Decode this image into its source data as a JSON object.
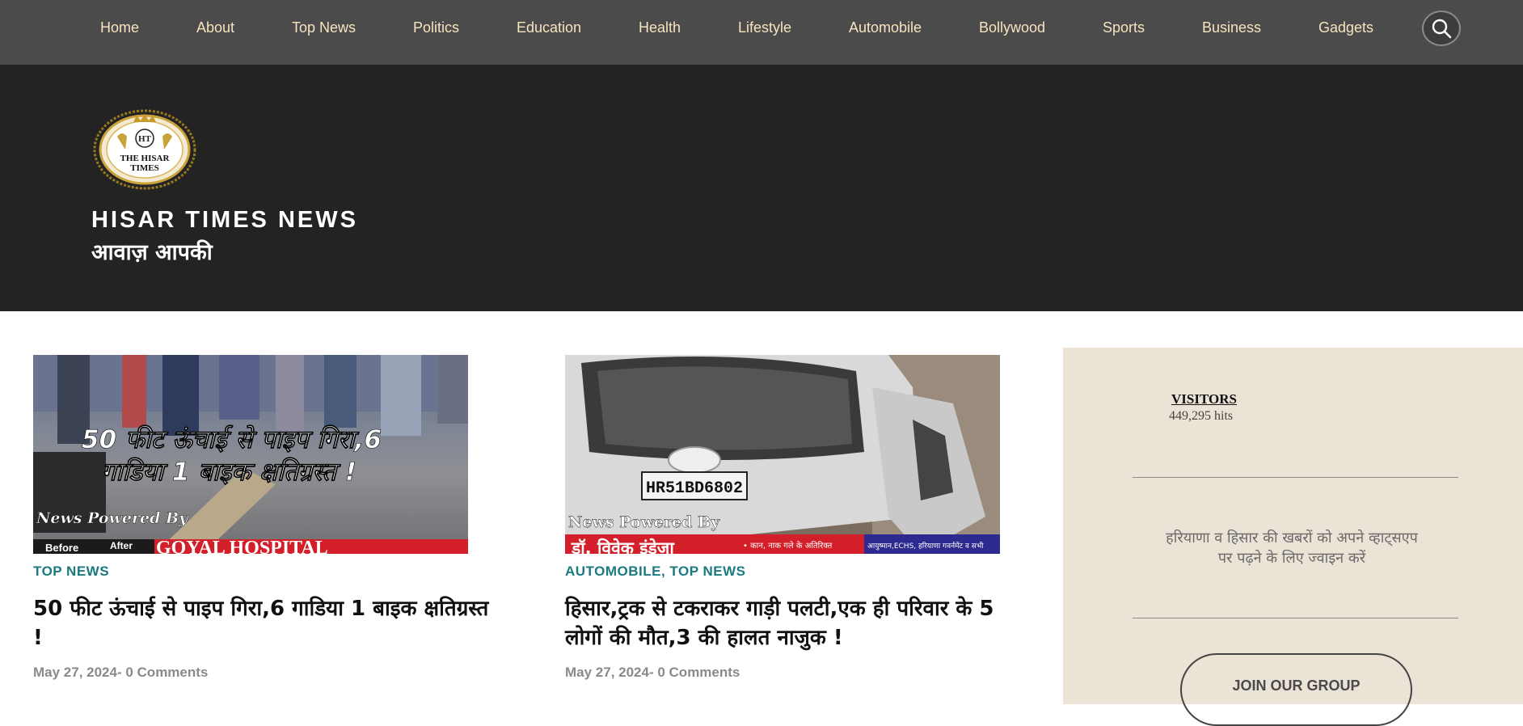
{
  "nav": {
    "items": [
      {
        "label": "Home"
      },
      {
        "label": "About"
      },
      {
        "label": "Top News"
      },
      {
        "label": "Politics"
      },
      {
        "label": "Education"
      },
      {
        "label": "Health"
      },
      {
        "label": "Lifestyle"
      },
      {
        "label": "Automobile"
      },
      {
        "label": "Bollywood"
      },
      {
        "label": "Sports"
      },
      {
        "label": "Business"
      },
      {
        "label": "Gadgets"
      }
    ],
    "search_icon": "search-icon"
  },
  "header": {
    "logo_text_top": "HT",
    "logo_text_main": "THE HISAR",
    "logo_text_sub": "TIMES",
    "title": "HISAR TIMES NEWS",
    "tagline": "आवाज़ आपकी"
  },
  "posts": [
    {
      "image_caption": "50 फीट ऊंचाई से पाइप गिरा,6 गाडिया 1 बाइक क्षतिग्रस्त !",
      "image_powered": "News Powered By",
      "image_banner_left": "Before",
      "image_banner_mid": "After",
      "image_banner": "GOYAL HOSPITAL",
      "categories": [
        "TOP NEWS"
      ],
      "title": "50 फीट ऊंचाई से पाइप गिरा,6 गाडिया 1 बाइक क्षतिग्रस्त !",
      "meta": "May 27, 2024- 0 Comments"
    },
    {
      "image_plate": "HR51BD6802",
      "image_powered": "News Powered By",
      "image_banner": "डॉ. विवेक इंडेजा",
      "image_banner_small": "• कान, नाक गले के अतिरिक्त",
      "image_banner_small2": "आयुष्मान,ECHS, हरियाणा गवर्नमेंट व सभी",
      "categories": [
        "AUTOMOBILE",
        "TOP NEWS"
      ],
      "title": "हिसार,ट्रक से टकराकर गाड़ी पलटी,एक ही परिवार के 5 लोगों की मौत,3 की हालत नाजुक !",
      "meta": "May 27, 2024- 0 Comments"
    }
  ],
  "sidebar": {
    "visitors_label": "VISITORS",
    "visitors_hits": "449,295 hits",
    "whatsapp_text": "हरियाणा व हिसार की खबरों को अपने व्हाट्सएप पर पढ़ने के लिए ज्वाइन करें",
    "join_label": "JOIN OUR GROUP"
  },
  "colors": {
    "nav_bg": "#4b4b4b",
    "nav_text": "#f6e3c0",
    "header_bg": "#232323",
    "category": "#1a7a80",
    "sidebar_bg": "#ebe3d6"
  }
}
